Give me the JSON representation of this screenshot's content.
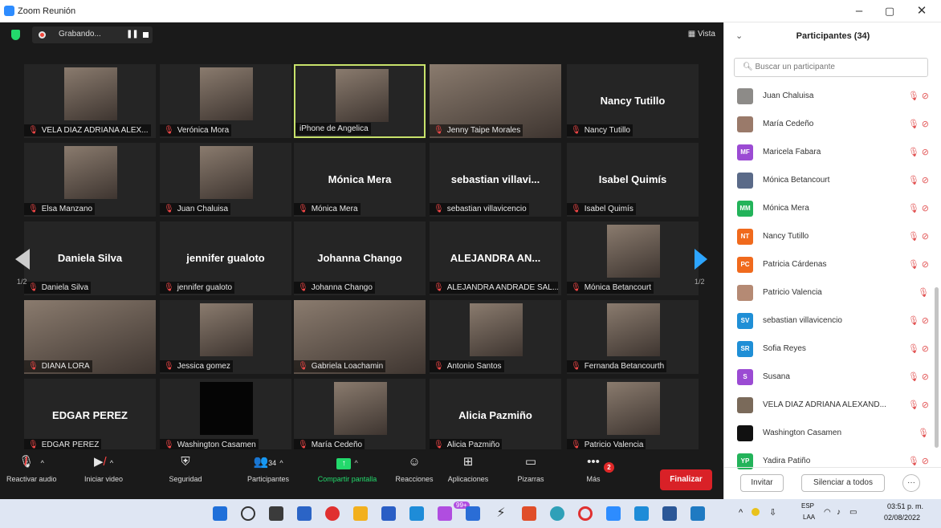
{
  "window": {
    "title": "Zoom Reunión",
    "minimize": "–",
    "maximize": "▢",
    "close": "✕"
  },
  "meeting": {
    "recording_label": "Grabando...",
    "view_label": "Vista",
    "page_left": "1/2",
    "page_right": "1/2",
    "tiles": [
      {
        "label": "VELA DIAZ ADRIANA ALEX...",
        "center": "",
        "photo": "photo",
        "muted": true
      },
      {
        "label": "Verónica Mora",
        "center": "",
        "photo": "photo",
        "muted": true
      },
      {
        "label": "iPhone de Angelica",
        "center": "",
        "photo": "photo",
        "muted": false,
        "active": true
      },
      {
        "label": "Jenny Taipe Morales",
        "center": "",
        "photo": "full",
        "muted": true
      },
      {
        "label": "Nancy Tutillo",
        "center": "Nancy Tutillo",
        "photo": "none",
        "muted": true
      },
      {
        "label": "Elsa Manzano",
        "center": "",
        "photo": "photo",
        "muted": true
      },
      {
        "label": "Juan Chaluisa",
        "center": "",
        "photo": "photo",
        "muted": true
      },
      {
        "label": "Mónica Mera",
        "center": "Mónica Mera",
        "photo": "none",
        "muted": true
      },
      {
        "label": "sebastian villavicencio",
        "center": "sebastian villavi...",
        "photo": "none",
        "muted": true
      },
      {
        "label": "Isabel Quimís",
        "center": "Isabel Quimís",
        "photo": "none",
        "muted": true
      },
      {
        "label": "Daniela Silva",
        "center": "Daniela Silva",
        "photo": "none",
        "muted": true
      },
      {
        "label": "jennifer gualoto",
        "center": "jennifer gualoto",
        "photo": "none",
        "muted": true
      },
      {
        "label": "Johanna Chango",
        "center": "Johanna Chango",
        "photo": "none",
        "muted": true
      },
      {
        "label": "ALEJANDRA ANDRADE SAL...",
        "center": "ALEJANDRA AN...",
        "photo": "none",
        "muted": true
      },
      {
        "label": "Mónica Betancourt",
        "center": "",
        "photo": "photo",
        "muted": true
      },
      {
        "label": "DIANA LORA",
        "center": "",
        "photo": "full",
        "muted": true
      },
      {
        "label": "Jessica gomez",
        "center": "",
        "photo": "photo",
        "muted": true
      },
      {
        "label": "Gabriela Loachamin",
        "center": "",
        "photo": "full",
        "muted": true
      },
      {
        "label": "Antonio Santos",
        "center": "",
        "photo": "photo",
        "muted": true
      },
      {
        "label": "Fernanda Betancourth",
        "center": "",
        "photo": "photo",
        "muted": true
      },
      {
        "label": "EDGAR PEREZ",
        "center": "EDGAR PEREZ",
        "photo": "none",
        "muted": true
      },
      {
        "label": "Washington Casamen",
        "center": "",
        "photo": "black",
        "muted": true
      },
      {
        "label": "María Cedeño",
        "center": "",
        "photo": "photo",
        "muted": true
      },
      {
        "label": "Alicia Pazmiño",
        "center": "Alicia Pazmiño",
        "photo": "none",
        "muted": true
      },
      {
        "label": "Patricio Valencia",
        "center": "",
        "photo": "photo",
        "muted": true
      }
    ]
  },
  "toolbar": {
    "unmute": "Reactivar audio",
    "start_video": "Iniciar video",
    "security": "Seguridad",
    "participants": "Participantes",
    "participants_count": "34",
    "share": "Compartir pantalla",
    "reactions": "Reacciones",
    "apps": "Aplicaciones",
    "whiteboards": "Pizarras",
    "more": "Más",
    "more_badge": "2",
    "end": "Finalizar"
  },
  "panel": {
    "title": "Participantes (34)",
    "search_placeholder": "Buscar un participante",
    "invite": "Invitar",
    "mute_all": "Silenciar a todos",
    "more": "···",
    "participants": [
      {
        "name": "Juan Chaluisa",
        "initials": "",
        "color": "#8d8b88",
        "icons": "mic-video"
      },
      {
        "name": "María Cedeño",
        "initials": "",
        "color": "#9a7a6a",
        "icons": "mic-video"
      },
      {
        "name": "Maricela Fabara",
        "initials": "MF",
        "color": "#9b4bd3",
        "icons": "mic-video"
      },
      {
        "name": "Mónica Betancourt",
        "initials": "",
        "color": "#5a6a88",
        "icons": "mic-video"
      },
      {
        "name": "Mónica Mera",
        "initials": "MM",
        "color": "#23b35a",
        "icons": "mic-video"
      },
      {
        "name": "Nancy Tutillo",
        "initials": "NT",
        "color": "#f06a1d",
        "icons": "mic-video"
      },
      {
        "name": "Patricia Cárdenas",
        "initials": "PC",
        "color": "#f06a1d",
        "icons": "mic-video"
      },
      {
        "name": "Patricio Valencia",
        "initials": "",
        "color": "#b58a74",
        "icons": "mic"
      },
      {
        "name": "sebastian villavicencio",
        "initials": "SV",
        "color": "#1f8fd6",
        "icons": "mic-video"
      },
      {
        "name": "Sofia Reyes",
        "initials": "SR",
        "color": "#1f8fd6",
        "icons": "mic-video"
      },
      {
        "name": "Susana",
        "initials": "S",
        "color": "#9b4bd3",
        "icons": "mic-video"
      },
      {
        "name": "VELA DIAZ ADRIANA ALEXAND...",
        "initials": "",
        "color": "#7a6a5a",
        "icons": "mic-video"
      },
      {
        "name": "Washington Casamen",
        "initials": "",
        "color": "#111111",
        "icons": "mic"
      },
      {
        "name": "Yadira Patiño",
        "initials": "YP",
        "color": "#23b35a",
        "icons": "mic-video"
      }
    ]
  },
  "taskbar": {
    "lang": "ESP",
    "lang2": "LAA",
    "time": "03:51 p. m.",
    "date": "02/08/2022",
    "store_badge": "99+"
  }
}
